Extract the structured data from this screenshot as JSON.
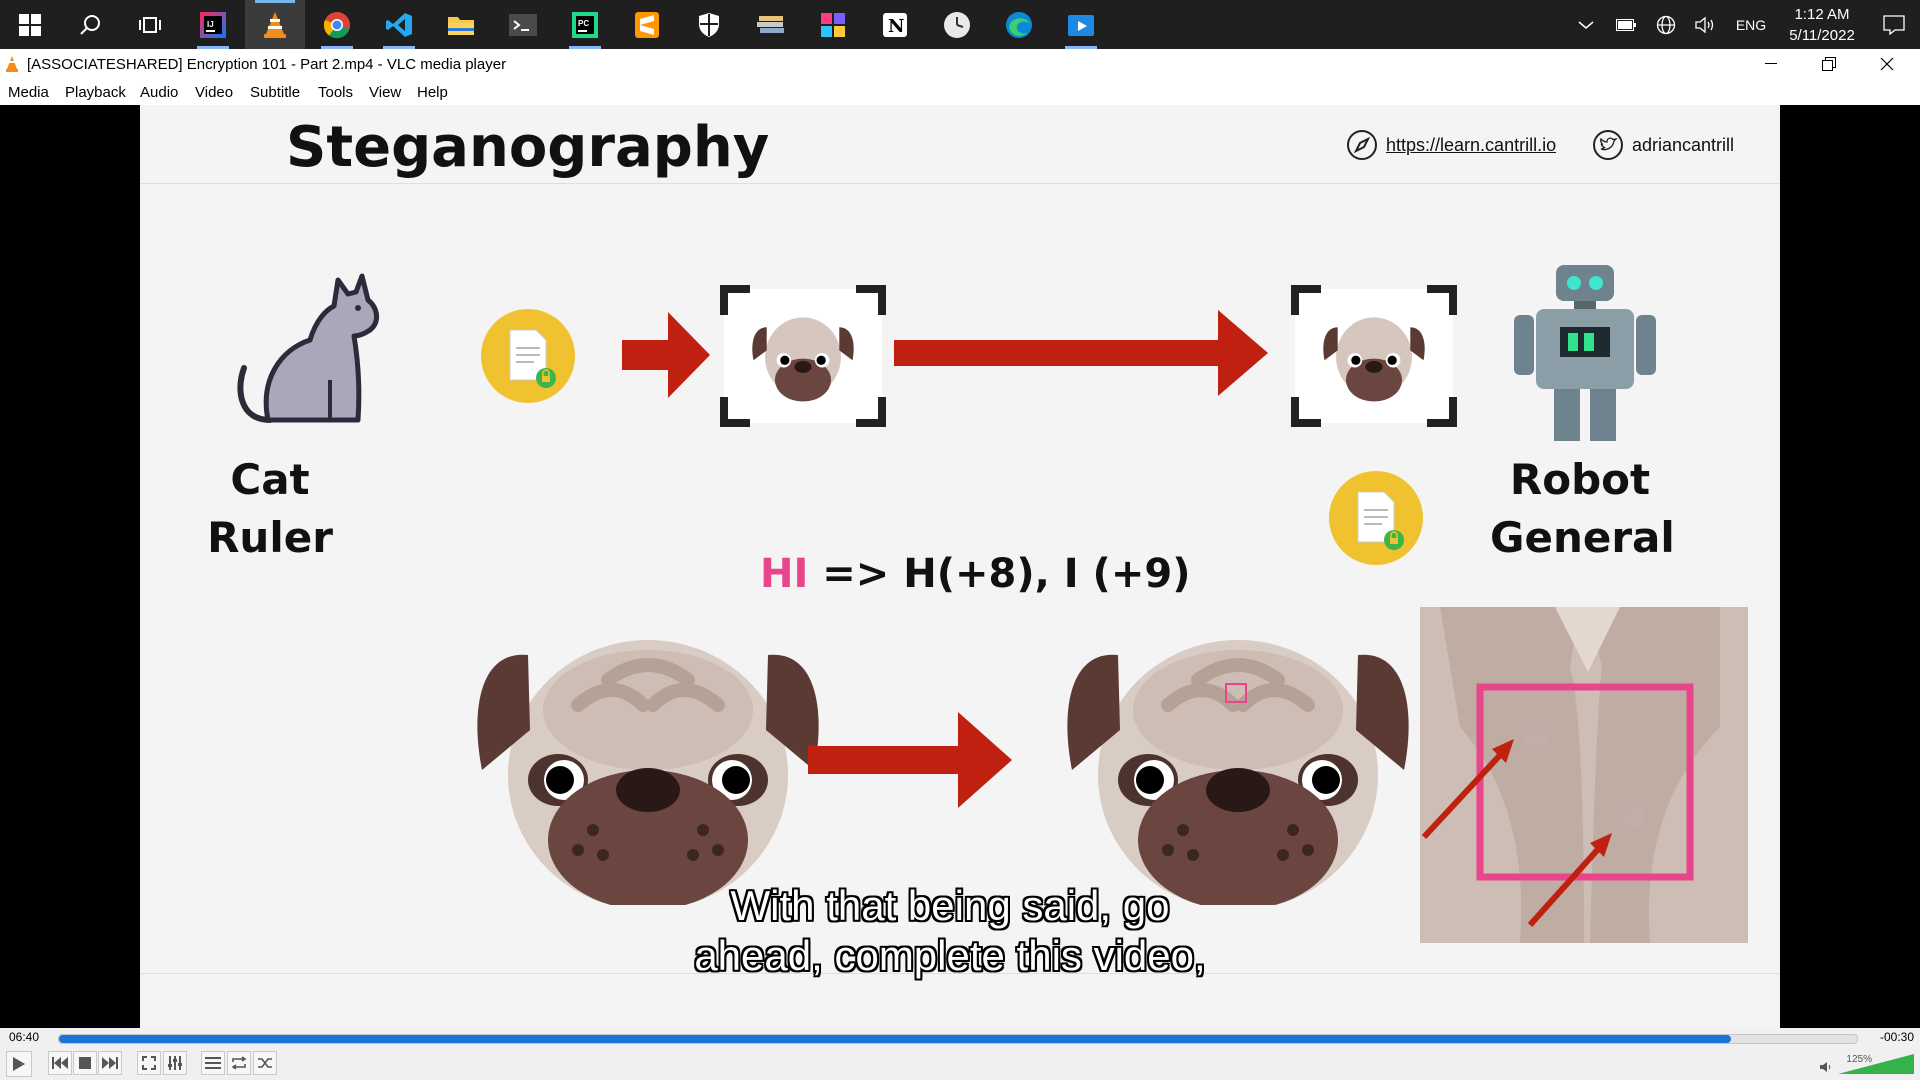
{
  "taskbar": {
    "apps": [
      "start",
      "search",
      "task-view",
      "intellij",
      "vlc",
      "chrome",
      "vscode",
      "file-explorer",
      "terminal",
      "pycharm",
      "sublime",
      "security",
      "stack-app",
      "rainbow-app",
      "notion",
      "clock-app",
      "edge",
      "media-app"
    ],
    "tray": {
      "language": "ENG",
      "time": "1:12 AM",
      "date": "5/11/2022"
    }
  },
  "window": {
    "title": "[ASSOCIATESHARED] Encryption 101 - Part 2.mp4 - VLC media player"
  },
  "menu": [
    "Media",
    "Playback",
    "Audio",
    "Video",
    "Subtitle",
    "Tools",
    "View",
    "Help"
  ],
  "slide": {
    "title": "Steganography",
    "url": "https://learn.cantrill.io",
    "handle": "adriancantrill",
    "cat_line1": "Cat",
    "cat_line2": "Ruler",
    "robot_line1": "Robot",
    "robot_line2": "General",
    "formula_hi": "HI",
    "formula_rest": " => H(+8), I (+9)",
    "colors": {
      "arrow": "#c0200f",
      "highlight": "#e8458b",
      "doc_circle": "#f0c230"
    }
  },
  "caption": {
    "line1": "With that being said, go",
    "line2": "ahead, complete this video,"
  },
  "player": {
    "elapsed": "06:40",
    "remaining": "-00:30",
    "progress": 0.93,
    "volume": "125%",
    "volume_level": 1.25
  }
}
